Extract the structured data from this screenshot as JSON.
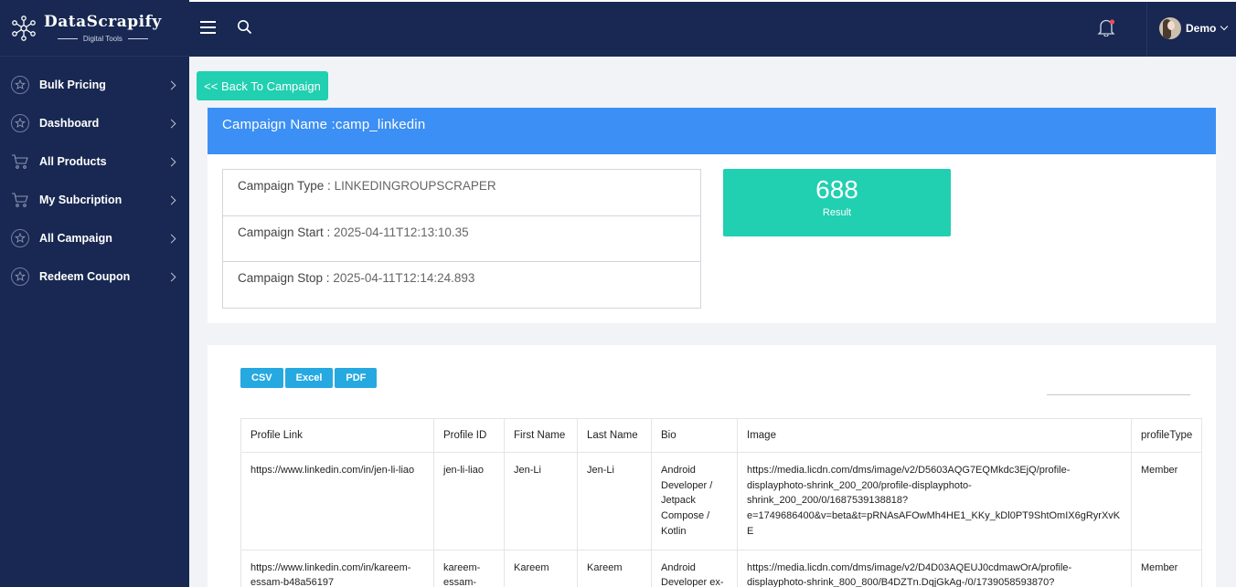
{
  "brand": {
    "name": "DataScrapify",
    "tagline": "Digital Tools"
  },
  "sidebar": {
    "items": [
      {
        "label": "Bulk Pricing",
        "icon": "badge-icon"
      },
      {
        "label": "Dashboard",
        "icon": "badge-icon"
      },
      {
        "label": "All Products",
        "icon": "cart-icon"
      },
      {
        "label": "My Subcription",
        "icon": "cart-icon"
      },
      {
        "label": "All Campaign",
        "icon": "badge-icon"
      },
      {
        "label": "Redeem Coupon",
        "icon": "badge-icon"
      }
    ]
  },
  "topbar": {
    "user_name": "Demo"
  },
  "back_button": "<< Back To Campaign",
  "campaign": {
    "header": "Campaign Name :camp_linkedin",
    "type_label": "Campaign Type : ",
    "type_value": "LINKEDINGROUPSCRAPER",
    "start_label": "Campaign Start : ",
    "start_value": "2025-04-11T12:13:10.35",
    "stop_label": "Campaign Stop : ",
    "stop_value": "2025-04-11T12:14:24.893"
  },
  "result": {
    "count": "688",
    "label": "Result"
  },
  "export": {
    "csv": "CSV",
    "excel": "Excel",
    "pdf": "PDF"
  },
  "table": {
    "headers": [
      "Profile Link",
      "Profile ID",
      "First Name",
      "Last Name",
      "Bio",
      "Image",
      "profileType"
    ],
    "rows": [
      {
        "profile_link": "https://www.linkedin.com/in/jen-li-liao",
        "profile_id": "jen-li-liao",
        "first_name": "Jen-Li",
        "last_name": "Jen-Li",
        "bio": "Android Developer / Jetpack Compose / Kotlin",
        "image": "https://media.licdn.com/dms/image/v2/D5603AQG7EQMkdc3EjQ/profile-displayphoto-shrink_200_200/profile-displayphoto-shrink_200_200/0/1687539138818?e=1749686400&v=beta&t=pRNAsAFOwMh4HE1_KKy_kDl0PT9ShtOmIX6gRyrXvKE",
        "profile_type": "Member"
      },
      {
        "profile_link": "https://www.linkedin.com/in/kareem-essam-b48a56197",
        "profile_id": "kareem-essam-",
        "first_name": "Kareem",
        "last_name": "Kareem",
        "bio": "Android Developer ex-",
        "image": "https://media.licdn.com/dms/image/v2/D4D03AQEUJ0cdmawOrA/profile-displayphoto-shrink_800_800/B4DZTn.DqjGkAg-/0/1739058593870?",
        "profile_type": "Member"
      }
    ]
  }
}
